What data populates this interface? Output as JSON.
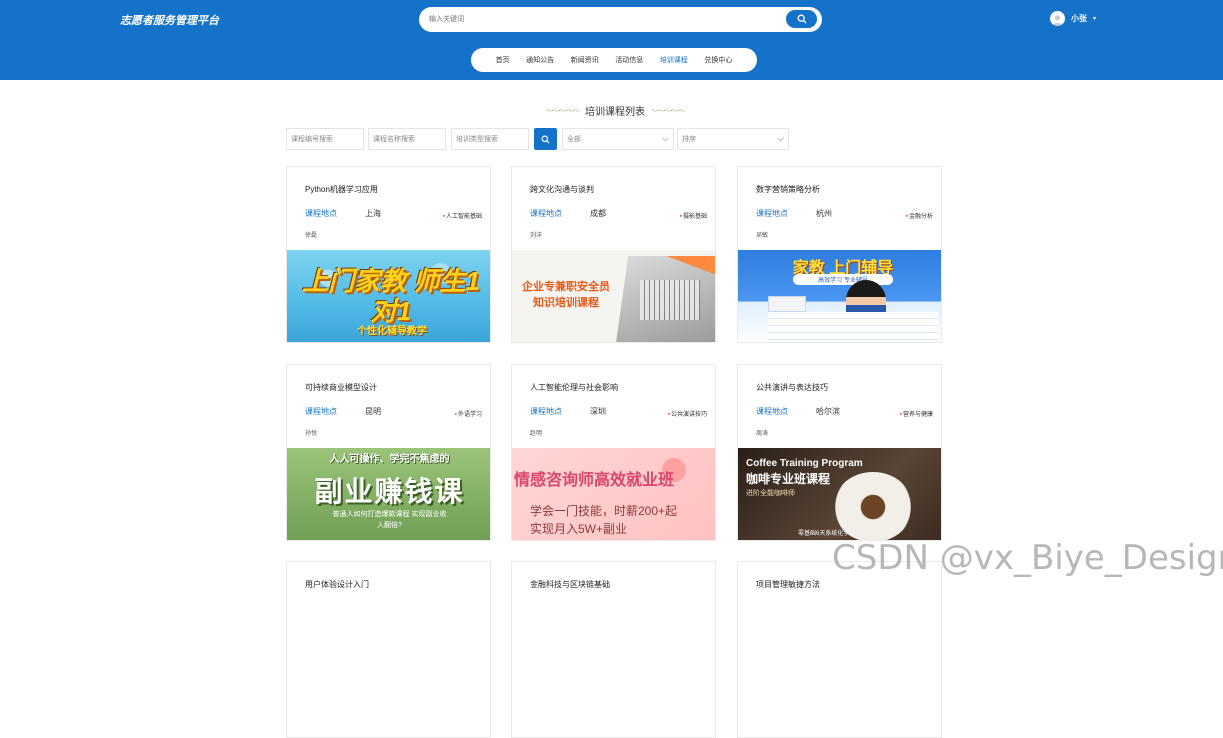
{
  "header": {
    "site_title": "志愿者服务管理平台",
    "search_placeholder": "输入关键词",
    "user_name": "小张",
    "caret": "▾"
  },
  "nav": {
    "items": [
      {
        "label": "首页",
        "active": false
      },
      {
        "label": "通知公告",
        "active": false
      },
      {
        "label": "新闻资讯",
        "active": false
      },
      {
        "label": "活动信息",
        "active": false
      },
      {
        "label": "培训课程",
        "active": true
      },
      {
        "label": "兑换中心",
        "active": false
      }
    ]
  },
  "list": {
    "title": "培训课程列表",
    "deco_left": "～･～･～･～･～",
    "deco_right": "～･～･～･～･～"
  },
  "filters": {
    "course_no_placeholder": "课程编号搜索",
    "course_name_placeholder": "课程名称搜索",
    "course_type_placeholder": "培训类型搜索",
    "category_select": "全部",
    "sort_select": "排序"
  },
  "cards": [
    {
      "title": "Python机器学习应用",
      "loc_label": "课程地点",
      "location": "上海",
      "tag": "人工智能基础",
      "teacher": "徐磊",
      "image_text": "上门家教 师生1对1",
      "image_sub": "个性化辅导教学"
    },
    {
      "title": "跨文化沟通与谈判",
      "loc_label": "课程地点",
      "location": "成都",
      "tag": "摄影基础",
      "teacher": "刘洋",
      "image_text": "企业专兼职安全员",
      "image_sub": "知识培训课程"
    },
    {
      "title": "数字营销策略分析",
      "loc_label": "课程地点",
      "location": "杭州",
      "tag": "金融分析",
      "teacher": "吴敏",
      "image_text": "家教 上门辅导",
      "image_sub": "高效学习 专业辅导"
    },
    {
      "title": "可持续商业模型设计",
      "loc_label": "课程地点",
      "location": "昆明",
      "tag": "外语学习",
      "teacher": "孙悦",
      "image_text": "副业赚钱课",
      "image_sub": "人人可操作、学完不焦虑的",
      "image_sub2": "普通人如何打造爆款课程 实现副业收入翻倍?"
    },
    {
      "title": "人工智能伦理与社会影响",
      "loc_label": "课程地点",
      "location": "深圳",
      "tag": "公共演讲技巧",
      "teacher": "赵明",
      "image_text": "情感咨询师高效就业班",
      "image_sub": "学会一门技能，时薪200+起",
      "image_sub2": "实现月入5W+副业"
    },
    {
      "title": "公共演讲与表达技巧",
      "loc_label": "课程地点",
      "location": "哈尔滨",
      "tag": "营养与健康",
      "teacher": "周涛",
      "image_text": "Coffee Training Program",
      "image_sub": "咖啡专业班课程",
      "image_sub2": "进阶全能咖啡师",
      "image_sub3": "零基础6天系统化学习"
    },
    {
      "title": "用户体验设计入门"
    },
    {
      "title": "金融科技与区块链基础"
    },
    {
      "title": "项目管理敏捷方法"
    }
  ],
  "watermark": "CSDN @vx_Biye_Design",
  "colors": {
    "brand": "#1473c8",
    "tag_dot": "#e33333"
  }
}
